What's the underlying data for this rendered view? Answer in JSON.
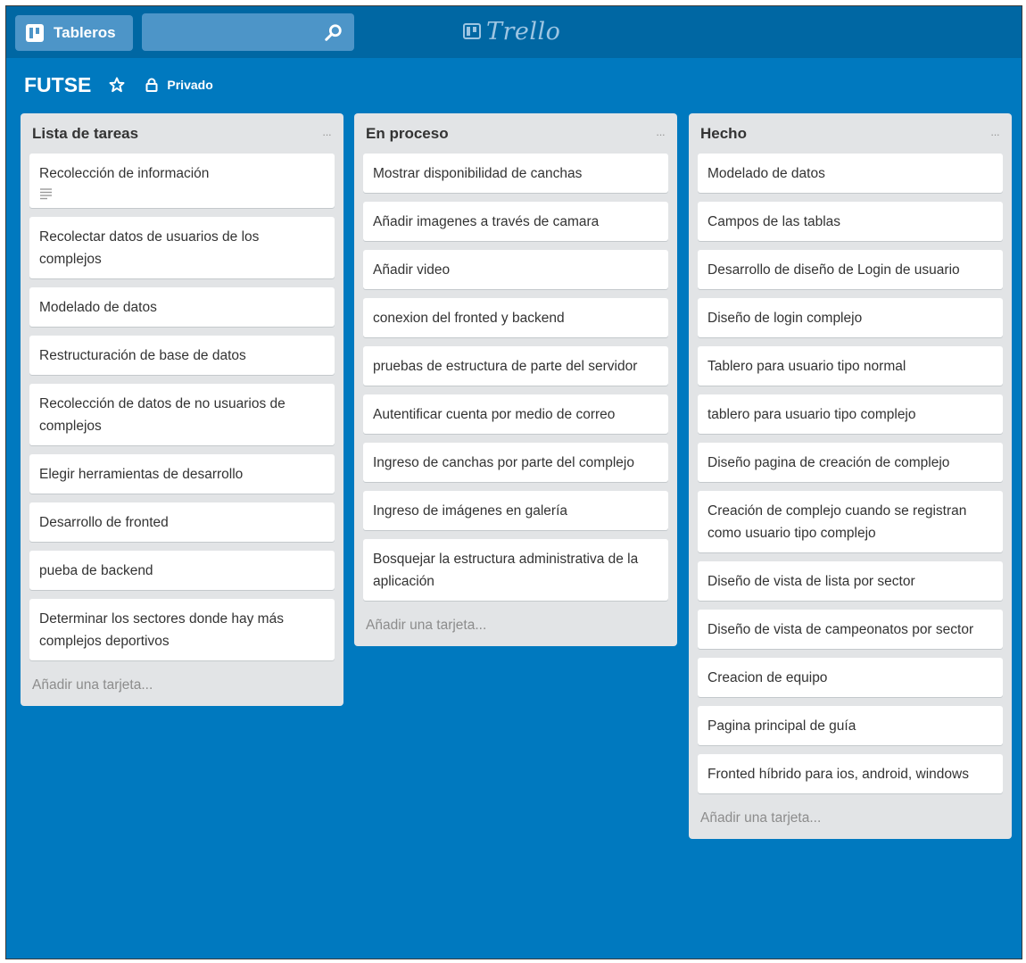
{
  "header": {
    "boards_label": "Tableros",
    "search_value": "",
    "logo_text": "Trello"
  },
  "board": {
    "title": "FUTSE",
    "visibility": "Privado"
  },
  "lists": [
    {
      "title": "Lista de tareas",
      "menu": "···",
      "add_card": "Añadir una tarjeta...",
      "cards": [
        "Recolección de información",
        "Recolectar datos de usuarios de los complejos",
        "Modelado de datos",
        "Restructuración de base de datos",
        "Recolección de datos de no usuarios de complejos",
        "Elegir herramientas de desarrollo",
        "Desarrollo de fronted",
        "pueba de backend",
        "Determinar los sectores donde hay más complejos deportivos"
      ]
    },
    {
      "title": "En proceso",
      "menu": "···",
      "add_card": "Añadir una tarjeta...",
      "cards": [
        "Mostrar disponibilidad de canchas",
        "Añadir imagenes a través de camara",
        "Añadir video",
        "conexion del fronted y backend",
        "pruebas de estructura de parte del servidor",
        "Autentificar cuenta por medio de correo",
        "Ingreso de canchas por parte del complejo",
        "Ingreso de imágenes en galería",
        "Bosquejar la estructura administrativa de la aplicación"
      ]
    },
    {
      "title": "Hecho",
      "menu": "···",
      "add_card": "Añadir una tarjeta...",
      "cards": [
        "Modelado de datos",
        "Campos de las tablas",
        "Desarrollo de diseño de Login de usuario",
        "Diseño de login complejo",
        "Tablero para usuario tipo normal",
        "tablero para usuario tipo complejo",
        "Diseño pagina de creación de complejo",
        "Creación de complejo cuando se registran como usuario tipo complejo",
        "Diseño de vista de lista por sector",
        "Diseño de vista de campeonatos por sector",
        "Creacion de equipo",
        "Pagina principal de guía",
        "Fronted híbrido para ios, android, windows"
      ]
    }
  ],
  "icons": {
    "boards": "boards-icon",
    "search": "search-icon",
    "star": "star-icon",
    "lock": "lock-icon",
    "description": "description-icon"
  },
  "colors": {
    "board_bg": "#0079bf",
    "topbar": "#0067a3",
    "list_bg": "#e2e4e6",
    "card_bg": "#ffffff"
  }
}
